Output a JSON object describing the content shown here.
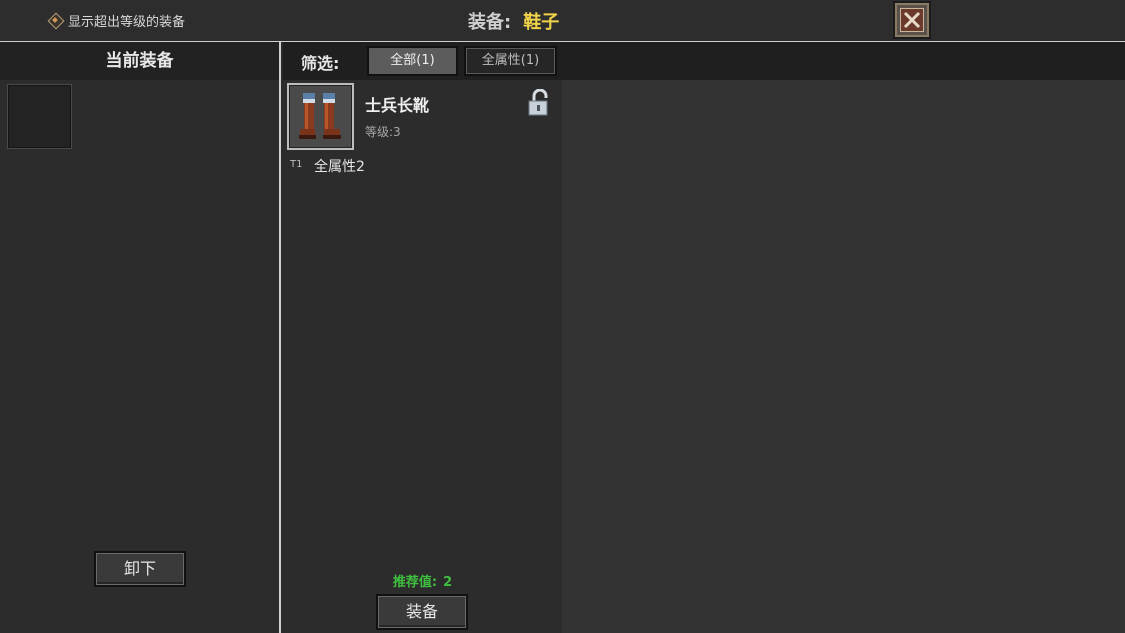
{
  "topbar": {
    "show_over_level_label": "显示超出等级的装备",
    "title_key": "装备:",
    "title_value": "鞋子"
  },
  "left": {
    "header": "当前装备",
    "unequip_label": "卸下"
  },
  "filter": {
    "label": "筛选:",
    "tabs": [
      {
        "label": "全部(1)",
        "selected": true
      },
      {
        "label": "全属性(1)",
        "selected": false
      }
    ]
  },
  "items": [
    {
      "name": "士兵长靴",
      "level_text": "等级:3",
      "tier": "T1",
      "attribute": "全属性2",
      "icon": "boots-icon",
      "locked": false
    }
  ],
  "recommend": {
    "label": "推荐值:",
    "value": "2"
  },
  "equip_label": "装备",
  "colors": {
    "title_accent": "#f0d34a",
    "recommend_green": "#3fbf3f"
  }
}
